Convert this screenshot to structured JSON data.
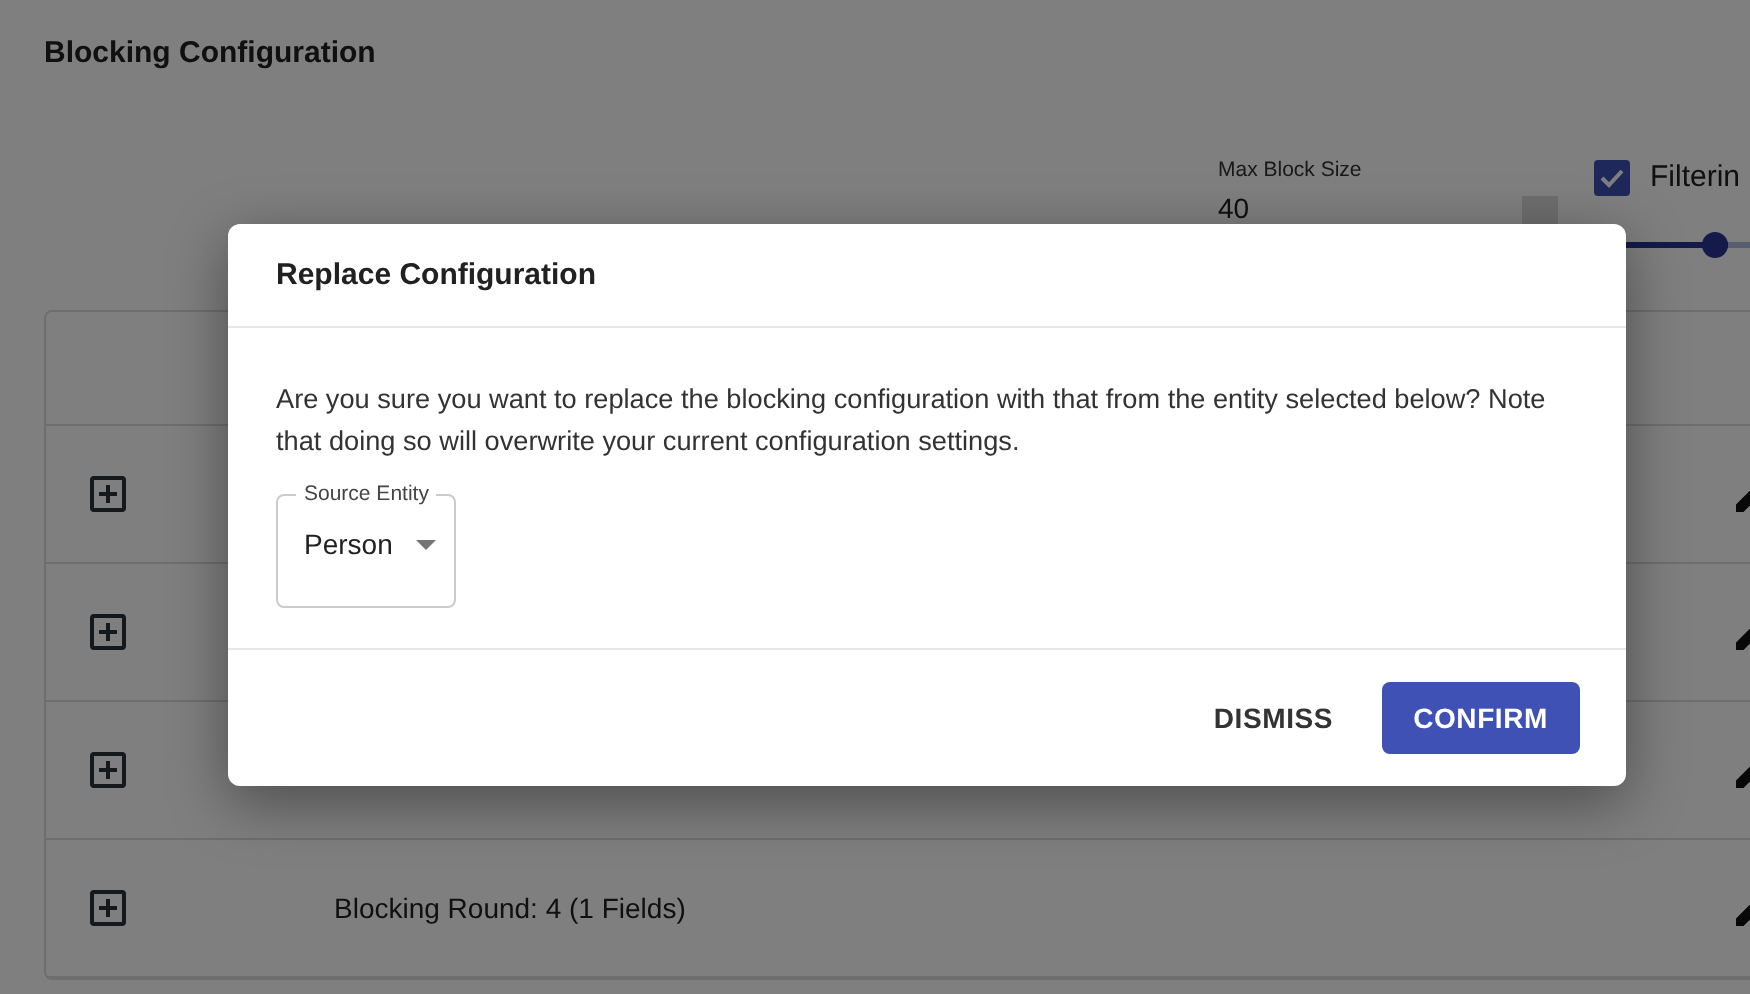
{
  "page": {
    "title": "Blocking Configuration"
  },
  "max_block_size": {
    "label": "Max Block Size",
    "value": "40"
  },
  "filtering": {
    "label": "Filterin",
    "checked": true
  },
  "slider": {
    "level": 0.96
  },
  "table": {
    "rows": [
      {
        "expanded": false
      },
      {
        "expanded": false
      },
      {
        "expanded": false
      },
      {
        "expanded": false,
        "label": "Blocking Round: 4 (1 Fields)"
      }
    ]
  },
  "dialog": {
    "title": "Replace Configuration",
    "message": "Are you sure you want to replace the blocking configuration with that from the entity selected below? Note that doing so will overwrite your current configuration settings.",
    "select": {
      "label": "Source Entity",
      "value": "Person"
    },
    "buttons": [
      {
        "label": "DISMISS",
        "kind": "text"
      },
      {
        "label": "CONFIRM",
        "kind": "primary"
      }
    ]
  }
}
